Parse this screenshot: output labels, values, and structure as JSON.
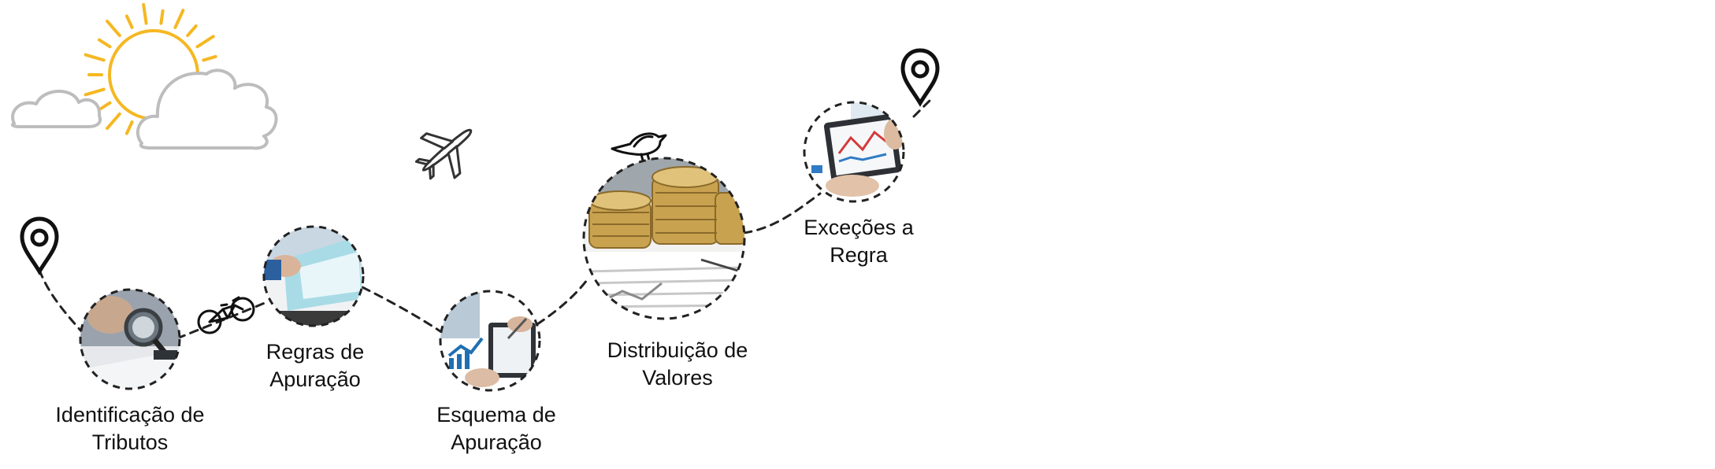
{
  "colors": {
    "sun": "#F5B823",
    "cloud": "#BDBDBD",
    "path": "#222222",
    "pin": "#111111"
  },
  "steps": [
    {
      "line1": "Identificação de",
      "line2": "Tributos",
      "image": "magnifier-on-documents"
    },
    {
      "line1": "Regras de",
      "line2": "Apuração",
      "image": "hands-turning-pages"
    },
    {
      "line1": "Esquema de",
      "line2": "Apuração",
      "image": "hand-with-pen-on-tablet-chart"
    },
    {
      "line1": "Distribuição de",
      "line2": "Valores",
      "image": "stacks-of-coins-on-report"
    },
    {
      "line1": "Exceções a",
      "line2": "Regra",
      "image": "hands-holding-tablet-chart"
    }
  ],
  "decorations": [
    "sun-icon",
    "cloud-icon",
    "airplane-icon",
    "bicycle-icon",
    "bird-icon",
    "location-pin-icon"
  ]
}
